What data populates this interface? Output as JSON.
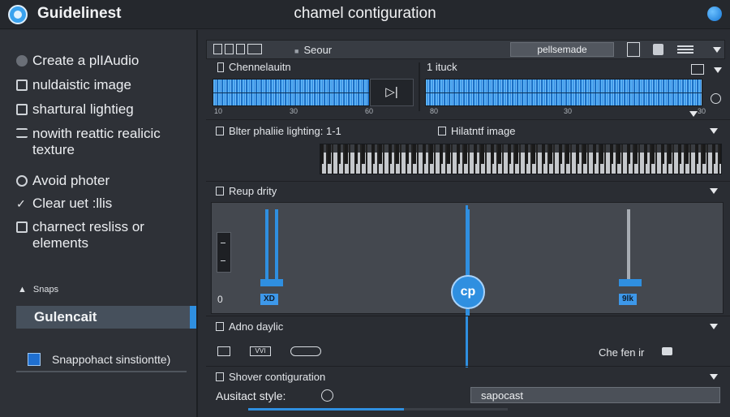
{
  "app": {
    "name": "Guidelinest",
    "window_title": "chamel contiguration"
  },
  "sidebar": {
    "items": [
      {
        "label": "Create a plIAudio"
      },
      {
        "label": "nuldaistic image"
      },
      {
        "label": "shartural lightieg"
      },
      {
        "label": "nowith reattic realicic texture"
      },
      {
        "label": "Avoid photer"
      },
      {
        "label": "Clear uet :llis"
      },
      {
        "label": "charnect resliss or elements"
      }
    ],
    "snaps_heading": "Snaps",
    "selected_item": "Gulencait",
    "snapshot_item": "Snappohact sinstiontte)"
  },
  "toolbar": {
    "label": "Seour",
    "input_value": "pellsemade"
  },
  "channels": {
    "left_title": "Chennelauitn",
    "left_ticks": [
      "10",
      "30",
      "60"
    ],
    "right_title": "1 ituck",
    "right_ticks": [
      "80",
      "30",
      "30"
    ],
    "play_label": "▷|"
  },
  "sections": {
    "lighting": "Blter phaliie lighting: 1-1",
    "image": "Hilatntf image",
    "rendering": "Reup drity",
    "audio": "Adno daylic",
    "config": "Shover contiguration"
  },
  "mixer": {
    "zero_label": "0",
    "fader_left_label": "XD",
    "knob_label": "cp",
    "fader_right_label": "9lk"
  },
  "audio_row": {
    "tag_label": "VVI",
    "right_label": "Che fen ir"
  },
  "config": {
    "style_label": "Ausitact style:",
    "style_input_value": "sapocast",
    "progress_fraction": 0.6
  },
  "colors": {
    "accent": "#2f8fe0",
    "panel": "#2a2d33",
    "sidebar": "#2e3137",
    "selected": "#46505c"
  },
  "icons": [
    "app-logo-icon",
    "globe-icon",
    "menu-icon",
    "chevron-down-icon",
    "play-icon",
    "record-icon",
    "chat-icon",
    "toggle-icon"
  ]
}
